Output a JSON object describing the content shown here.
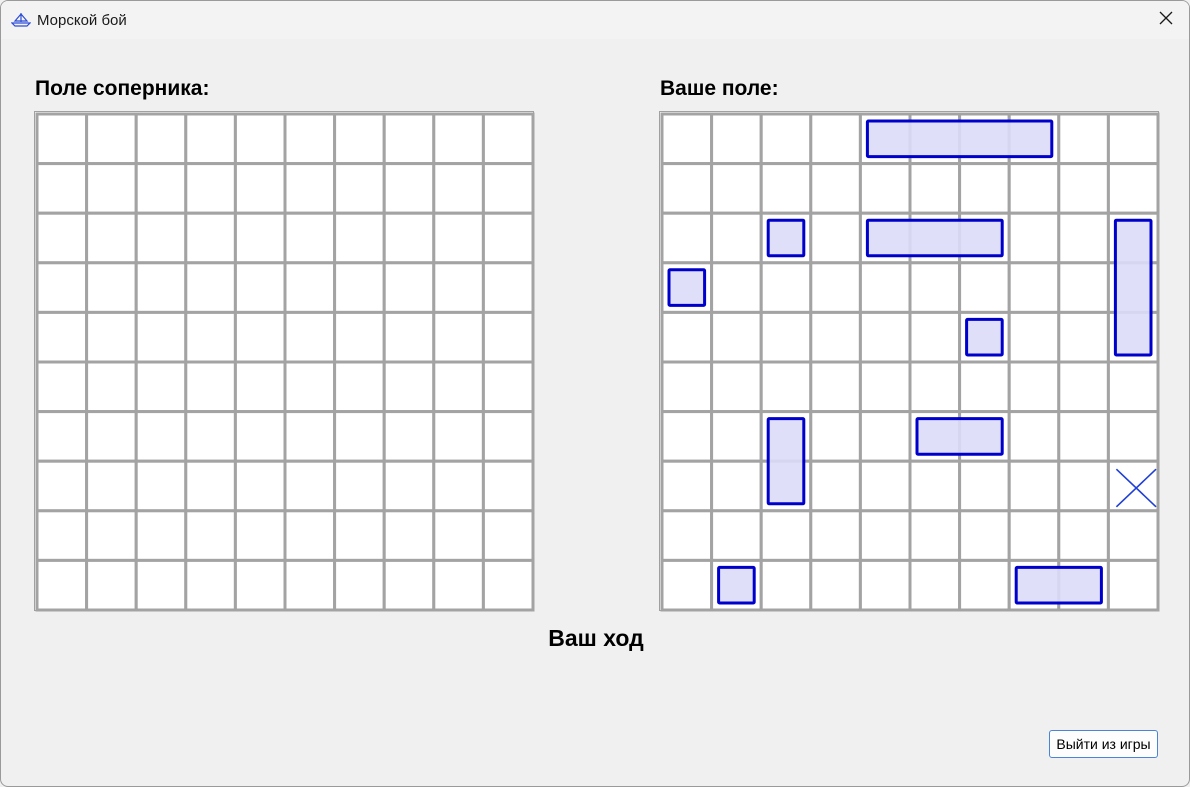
{
  "window": {
    "title": "Морской бой",
    "app_icon": "boat-icon",
    "close_icon": "close-icon"
  },
  "opponent_board": {
    "label": "Поле соперника:",
    "rows": 10,
    "cols": 10
  },
  "player_board": {
    "label": "Ваше поле:",
    "rows": 10,
    "cols": 10,
    "ships": [
      {
        "row": 0,
        "col": 4,
        "length": 4,
        "orientation": "horizontal"
      },
      {
        "row": 2,
        "col": 2,
        "length": 1,
        "orientation": "horizontal"
      },
      {
        "row": 2,
        "col": 4,
        "length": 3,
        "orientation": "horizontal"
      },
      {
        "row": 2,
        "col": 9,
        "length": 3,
        "orientation": "vertical"
      },
      {
        "row": 3,
        "col": 0,
        "length": 1,
        "orientation": "horizontal"
      },
      {
        "row": 4,
        "col": 6,
        "length": 1,
        "orientation": "horizontal"
      },
      {
        "row": 6,
        "col": 2,
        "length": 2,
        "orientation": "vertical"
      },
      {
        "row": 6,
        "col": 5,
        "length": 2,
        "orientation": "horizontal"
      },
      {
        "row": 9,
        "col": 1,
        "length": 1,
        "orientation": "horizontal"
      },
      {
        "row": 9,
        "col": 7,
        "length": 2,
        "orientation": "horizontal"
      }
    ],
    "misses": [
      {
        "row": 7,
        "col": 9
      }
    ]
  },
  "status": {
    "turn_text": "Ваш ход"
  },
  "controls": {
    "exit_label": "Выйти из игры"
  },
  "colors": {
    "grid_line": "#a3a3a3",
    "cell_bg": "#ffffff",
    "ship_stroke": "#0000cc",
    "ship_fill": "#dcdcf8",
    "miss_mark": "#1f3fd6"
  }
}
